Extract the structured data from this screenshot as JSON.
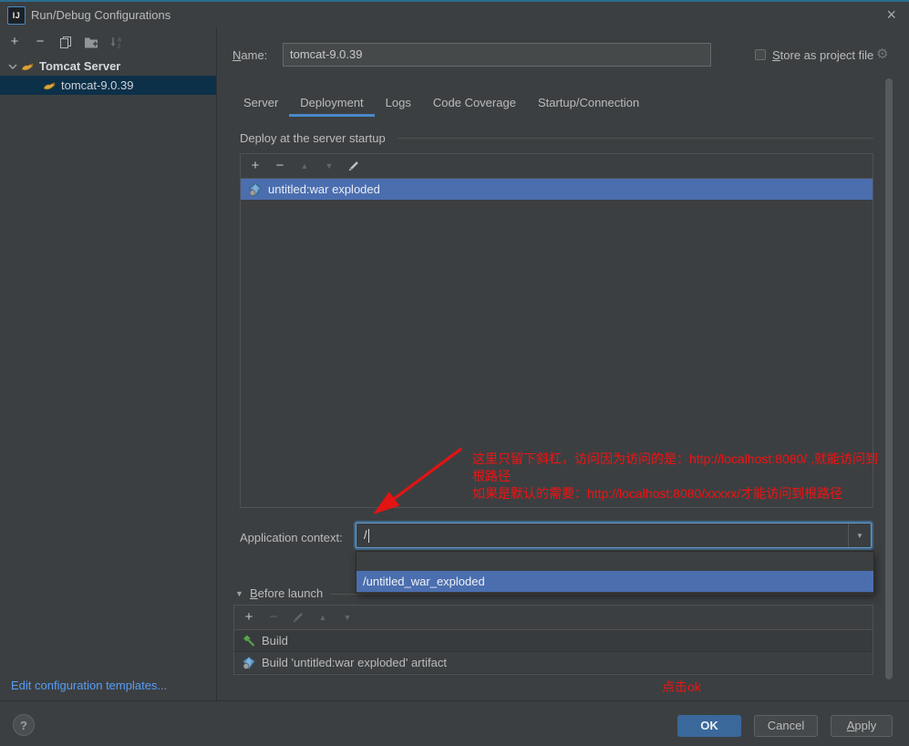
{
  "window": {
    "title": "Run/Debug Configurations"
  },
  "icons": {
    "add": "+",
    "remove": "−",
    "move_up": "▲",
    "move_down": "▼",
    "close": "×",
    "gear": "⚙",
    "help": "?",
    "combo_arrow": "▼",
    "section_arrow": "▼"
  },
  "sidebar": {
    "tree": {
      "root": "Tomcat Server",
      "child": "tomcat-9.0.39"
    },
    "edit_templates_link": "Edit configuration templates..."
  },
  "form": {
    "name_label": {
      "mnemonic": "N",
      "rest": "ame:"
    },
    "name_value": "tomcat-9.0.39",
    "store_label": {
      "mnemonic": "S",
      "rest": "tore as project file"
    },
    "tabs": [
      "Server",
      "Deployment",
      "Logs",
      "Code Coverage",
      "Startup/Connection"
    ],
    "active_tab": "Deployment",
    "deploy": {
      "title": "Deploy at the server startup",
      "item": "untitled:war exploded"
    },
    "app_context": {
      "label": "Application context:",
      "value": "/",
      "dropdown_item": "/untitled_war_exploded"
    },
    "before_launch": {
      "title": {
        "mnemonic": "B",
        "rest": "efore launch"
      },
      "items": [
        "Build",
        "Build 'untitled:war exploded' artifact"
      ]
    }
  },
  "annotation": {
    "lines": [
      "这里只留下斜杠，访问因为访问的是：http://localhost:8080/ ,就能访问到",
      "根路径",
      "如果是默认的需要：http://localhost:8080/xxxxx/才能访问到根路径"
    ],
    "click_ok": "点击ok",
    "color": "#f31212"
  },
  "footer": {
    "ok": "OK",
    "cancel": "Cancel",
    "apply": {
      "mnemonic": "A",
      "rest": "pply"
    },
    "help": "?"
  },
  "colors": {
    "background": "#3c3f41",
    "selection_blue": "#4b6eaf",
    "sidebar_selection": "#0d3049",
    "tab_underline": "#4a88c7",
    "link": "#589df6",
    "ok_button": "#3a689b",
    "top_accent": "#2a6d8e",
    "focus_ring": "#3f688c",
    "annotation_red": "#f31212"
  }
}
